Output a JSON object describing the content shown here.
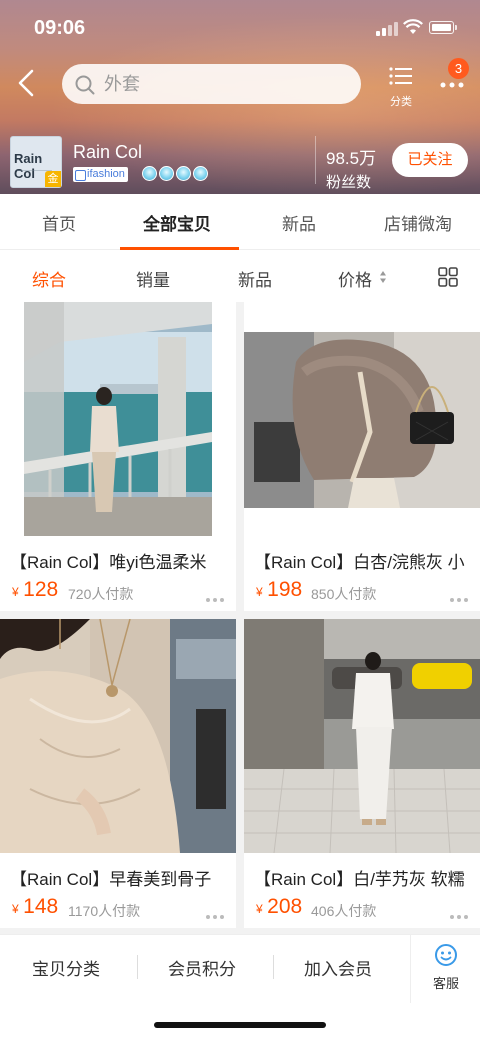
{
  "status_bar": {
    "time": "09:06"
  },
  "search": {
    "placeholder": "外套"
  },
  "top_actions": {
    "category_label": "分类",
    "message_badge": "3"
  },
  "shop": {
    "logo_text": "Rain Col",
    "logo_badge": "金",
    "name": "Rain Col",
    "tag": "ifashion",
    "crown_count": 4,
    "fans_count": "98.5万",
    "fans_label": "粉丝数",
    "follow_label": "已关注"
  },
  "tabs": [
    {
      "label": "首页"
    },
    {
      "label": "全部宝贝",
      "active": true
    },
    {
      "label": "新品"
    },
    {
      "label": "店铺微淘"
    }
  ],
  "filters": [
    {
      "label": "综合",
      "active": true
    },
    {
      "label": "销量"
    },
    {
      "label": "新品"
    },
    {
      "label": "价格"
    }
  ],
  "products": [
    {
      "title": "【Rain Col】唯yi色温柔米",
      "yen": "¥",
      "price": "128",
      "sold": "720人付款"
    },
    {
      "title": "【Rain Col】白杏/浣熊灰 小",
      "yen": "¥",
      "price": "198",
      "sold": "850人付款"
    },
    {
      "title": "【Rain Col】早春美到骨子",
      "yen": "¥",
      "price": "148",
      "sold": "1170人付款"
    },
    {
      "title": "【Rain Col】白/芋艿灰 软糯",
      "yen": "¥",
      "price": "208",
      "sold": "406人付款"
    }
  ],
  "bottom_bar": {
    "items": [
      {
        "label": "宝贝分类"
      },
      {
        "label": "会员积分"
      },
      {
        "label": "加入会员"
      }
    ],
    "service_label": "客服"
  },
  "colors": {
    "accent": "#ff5000",
    "price": "#ff5000"
  }
}
